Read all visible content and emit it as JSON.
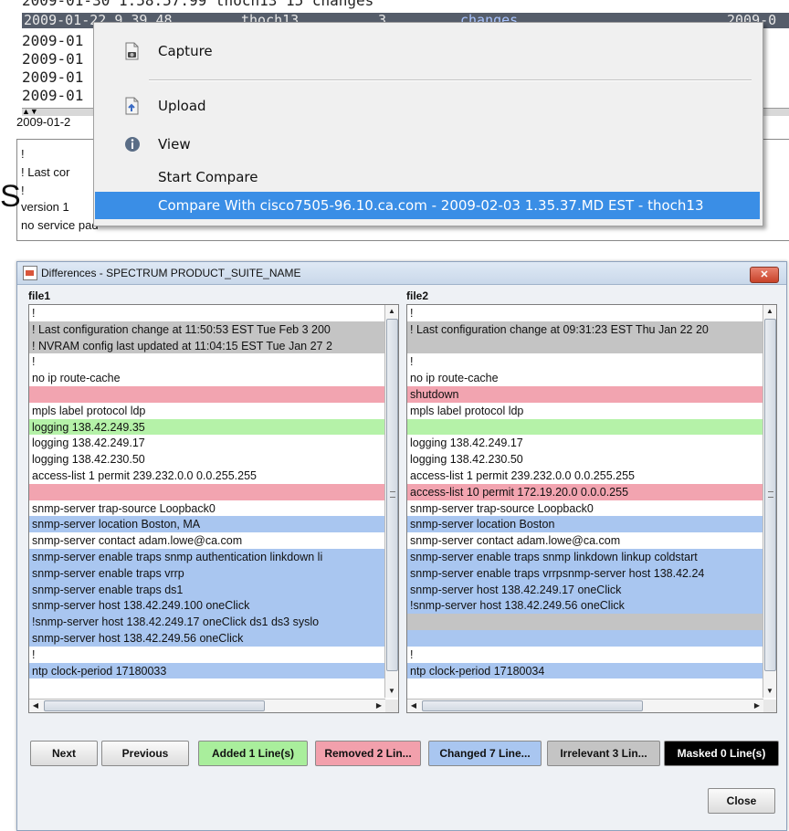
{
  "background": {
    "selected_row": {
      "date": "2009-01-22 9.39.48",
      "user": "thoch13",
      "num": "3",
      "link": "changes",
      "end": "2009-0"
    },
    "top_row_partial": "2009-01-30 1.58.57.99  thoch13    15    changes",
    "rows": [
      "2009-01",
      "2009-01",
      "2009-01",
      "2009-01"
    ],
    "date_label": "2009-01-2",
    "config_text": [
      "!",
      "! Last cor",
      "!",
      "version 1",
      "no service pad"
    ],
    "big_letter": "S"
  },
  "context_menu": {
    "items": [
      {
        "label": "Capture",
        "icon": "capture-icon"
      },
      {
        "label": "Upload",
        "icon": "upload-icon"
      },
      {
        "label": "View",
        "icon": "info-icon"
      },
      {
        "label": "Start Compare",
        "icon": ""
      },
      {
        "label": "Compare With cisco7505-96.10.ca.com - 2009-02-03 1.35.37.MD EST - thoch13",
        "icon": ""
      }
    ]
  },
  "dialog": {
    "title": "Differences - SPECTRUM PRODUCT_SUITE_NAME",
    "file1_label": "file1",
    "file2_label": "file2",
    "file1_lines": [
      {
        "text": "!",
        "kind": "none"
      },
      {
        "text": "! Last configuration change at 11:50:53 EST Tue Feb 3 200",
        "kind": "irr"
      },
      {
        "text": "! NVRAM config last updated at 11:04:15 EST Tue Jan 27 2",
        "kind": "irr"
      },
      {
        "text": "!",
        "kind": "none"
      },
      {
        "text": "no ip route-cache",
        "kind": "none"
      },
      {
        "text": "",
        "kind": "rem"
      },
      {
        "text": "mpls label protocol ldp",
        "kind": "none"
      },
      {
        "text": "logging 138.42.249.35",
        "kind": "add"
      },
      {
        "text": "logging 138.42.249.17",
        "kind": "none"
      },
      {
        "text": "logging 138.42.230.50",
        "kind": "none"
      },
      {
        "text": "access-list 1 permit 239.232.0.0 0.0.255.255",
        "kind": "none"
      },
      {
        "text": "",
        "kind": "rem"
      },
      {
        "text": "snmp-server trap-source Loopback0",
        "kind": "none"
      },
      {
        "text": "snmp-server location Boston, MA",
        "kind": "chg"
      },
      {
        "text": "snmp-server contact adam.lowe@ca.com",
        "kind": "none"
      },
      {
        "text": "snmp-server enable traps snmp authentication linkdown li",
        "kind": "chg"
      },
      {
        "text": "snmp-server enable traps vrrp",
        "kind": "chg"
      },
      {
        "text": "snmp-server enable traps ds1",
        "kind": "chg"
      },
      {
        "text": "snmp-server host 138.42.249.100 oneClick",
        "kind": "chg"
      },
      {
        "text": "!snmp-server host 138.42.249.17 oneClick  ds1 ds3 syslo",
        "kind": "chg"
      },
      {
        "text": "snmp-server host 138.42.249.56 oneClick",
        "kind": "chg"
      },
      {
        "text": "!",
        "kind": "none"
      },
      {
        "text": "ntp clock-period 17180033",
        "kind": "chg"
      }
    ],
    "file2_lines": [
      {
        "text": "!",
        "kind": "none"
      },
      {
        "text": "! Last configuration change at 09:31:23 EST Thu Jan 22 20",
        "kind": "irr"
      },
      {
        "text": "",
        "kind": "irr"
      },
      {
        "text": "!",
        "kind": "none"
      },
      {
        "text": "no ip route-cache",
        "kind": "none"
      },
      {
        "text": "shutdown",
        "kind": "rem"
      },
      {
        "text": "mpls label protocol ldp",
        "kind": "none"
      },
      {
        "text": "",
        "kind": "add"
      },
      {
        "text": "logging 138.42.249.17",
        "kind": "none"
      },
      {
        "text": "logging 138.42.230.50",
        "kind": "none"
      },
      {
        "text": "access-list 1 permit 239.232.0.0 0.0.255.255",
        "kind": "none"
      },
      {
        "text": "access-list 10 permit 172.19.20.0 0.0.0.255",
        "kind": "rem"
      },
      {
        "text": "snmp-server trap-source Loopback0",
        "kind": "none"
      },
      {
        "text": "snmp-server location Boston",
        "kind": "chg"
      },
      {
        "text": "snmp-server contact adam.lowe@ca.com",
        "kind": "none"
      },
      {
        "text": "snmp-server enable traps snmp linkdown linkup coldstart",
        "kind": "chg"
      },
      {
        "text": "snmp-server enable traps vrrpsnmp-server host 138.42.24",
        "kind": "chg"
      },
      {
        "text": "snmp-server host 138.42.249.17 oneClick",
        "kind": "chg"
      },
      {
        "text": "!snmp-server host 138.42.249.56 oneClick",
        "kind": "chg"
      },
      {
        "text": "",
        "kind": "irr"
      },
      {
        "text": "",
        "kind": "chg"
      },
      {
        "text": "!",
        "kind": "none"
      },
      {
        "text": "ntp clock-period 17180034",
        "kind": "chg"
      }
    ],
    "buttons": {
      "next": "Next",
      "previous": "Previous",
      "added": "Added 1 Line(s)",
      "removed": "Removed 2 Lin...",
      "changed": "Changed 7 Line...",
      "irrelevant": "Irrelevant 3 Lin...",
      "masked": "Masked 0 Line(s)",
      "close": "Close"
    },
    "colors": {
      "irrelevant": "#c4c4c4",
      "removed": "#f2a4b0",
      "added": "#b5f2a8",
      "changed": "#a9c6f0",
      "masked": "#000000"
    }
  }
}
